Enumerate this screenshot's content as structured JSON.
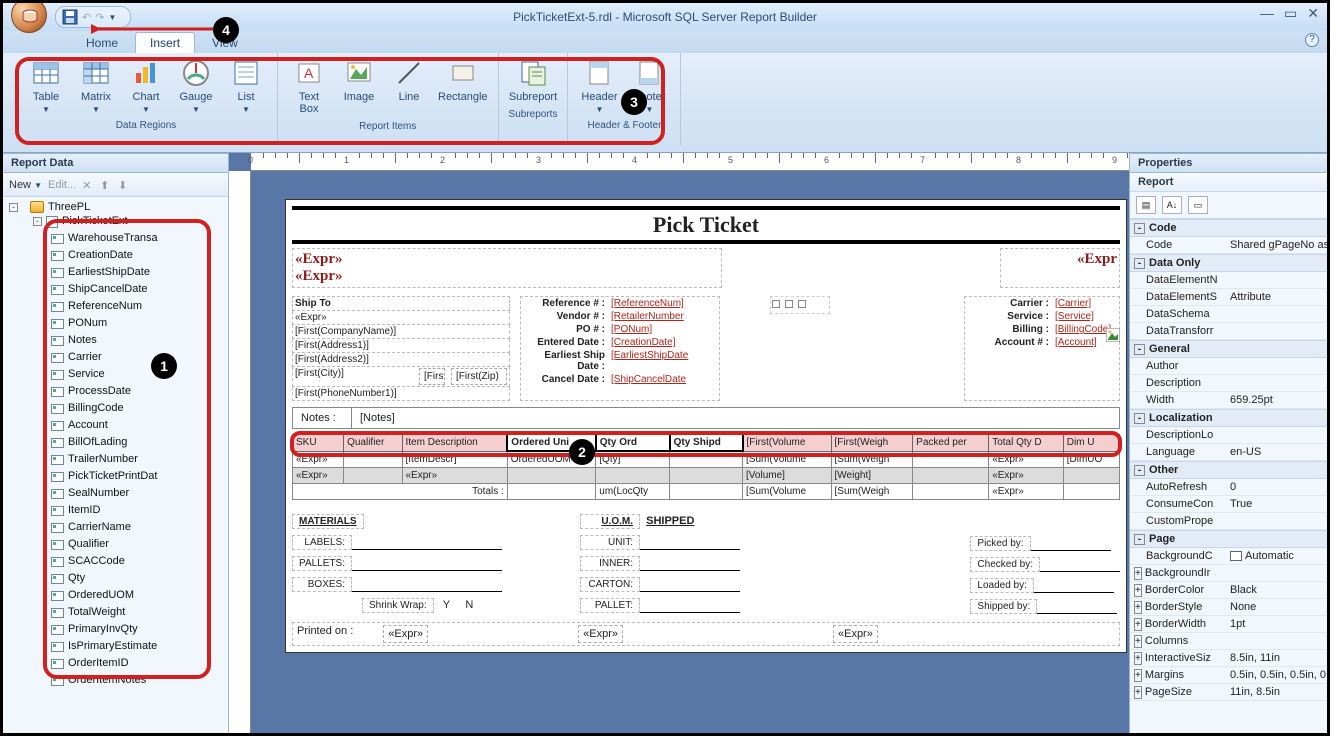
{
  "title": "PickTicketExt-5.rdl - Microsoft SQL Server Report Builder",
  "tabs": [
    "Home",
    "Insert",
    "View"
  ],
  "active_tab": 1,
  "ribbon": {
    "groups": [
      {
        "label": "Data Regions",
        "items": [
          {
            "name": "table-btn",
            "label": "Table",
            "dd": true
          },
          {
            "name": "matrix-btn",
            "label": "Matrix",
            "dd": true
          },
          {
            "name": "chart-btn",
            "label": "Chart",
            "dd": true
          },
          {
            "name": "gauge-btn",
            "label": "Gauge",
            "dd": true
          },
          {
            "name": "list-btn",
            "label": "List",
            "dd": true
          }
        ]
      },
      {
        "label": "Report Items",
        "items": [
          {
            "name": "textbox-btn",
            "label": "Text\nBox"
          },
          {
            "name": "image-btn",
            "label": "Image"
          },
          {
            "name": "line-btn",
            "label": "Line"
          },
          {
            "name": "rectangle-btn",
            "label": "Rectangle"
          }
        ]
      },
      {
        "label": "Subreports",
        "items": [
          {
            "name": "subreport-btn",
            "label": "Subreport"
          }
        ]
      },
      {
        "label": "Header & Footer",
        "items": [
          {
            "name": "header-btn",
            "label": "Header",
            "dd": true
          },
          {
            "name": "footer-btn",
            "label": "Footer",
            "dd": true
          }
        ]
      }
    ]
  },
  "callouts": {
    "c1": "1",
    "c2": "2",
    "c3": "3",
    "c4": "4"
  },
  "leftpanel": {
    "title": "Report Data",
    "new": "New",
    "edit": "Edit...",
    "datasource": "ThreePL",
    "dataset": "PickTicketExt",
    "fields": [
      "WarehouseTransa",
      "CreationDate",
      "EarliestShipDate",
      "ShipCancelDate",
      "ReferenceNum",
      "PONum",
      "Notes",
      "Carrier",
      "Service",
      "ProcessDate",
      "BillingCode",
      "Account",
      "BillOfLading",
      "TrailerNumber",
      "PickTicketPrintDat",
      "SealNumber",
      "ItemID",
      "CarrierName",
      "Qualifier",
      "SCACCode",
      "Qty",
      "OrderedUOM",
      "TotalWeight",
      "PrimaryInvQty",
      "IsPrimaryEstimate",
      "OrderItemID",
      "OrderItemNotes"
    ]
  },
  "report": {
    "title": "Pick Ticket",
    "expr": "«Expr»",
    "shipto": "Ship To",
    "shipfields": [
      "«Expr»",
      "[First(CompanyName)]",
      "[First(Address1)]",
      "[First(Address2)]",
      "[First(City)]",
      "[First(PhoneNumber1)]"
    ],
    "shipaux": [
      "[Firs",
      "[First(Zip)"
    ],
    "refs": [
      {
        "k": "Reference # :",
        "v": "[ReferenceNum]"
      },
      {
        "k": "Vendor # :",
        "v": "[RetailerNumber"
      },
      {
        "k": "PO # :",
        "v": "[PONum]"
      },
      {
        "k": "Entered Date :",
        "v": "[CreationDate]"
      },
      {
        "k": "Earliest Ship Date :",
        "v": "[EarliestShipDate"
      },
      {
        "k": "Cancel Date :",
        "v": "[ShipCancelDate"
      }
    ],
    "carrier": [
      {
        "k": "Carrier :",
        "v": "[Carrier]"
      },
      {
        "k": "Service :",
        "v": "[Service]"
      },
      {
        "k": "Billing :",
        "v": "[BillingCode]"
      },
      {
        "k": "Account # :",
        "v": "[Account]"
      }
    ],
    "notes_label": "Notes :",
    "notes_val": "[Notes]",
    "cols": [
      "SKU",
      "Qualifier",
      "Item Description",
      "Ordered Uni",
      "Qty Ord",
      "Qty Shipd",
      "[First(Volume",
      "[First(Weigh",
      "Packed per",
      "Total Qty D",
      "Dim U"
    ],
    "row1": [
      "«Expr»",
      "",
      "[ItemDescr]",
      "OrderedUOM",
      "[Qty]",
      "",
      "[Sum(Volume",
      "[Sum(Weigh",
      "",
      "«Expr»",
      "[DimUO"
    ],
    "row2": [
      "«Expr»",
      "",
      "«Expr»",
      "",
      "",
      "",
      "[Volume]",
      "[Weight]",
      "",
      "«Expr»",
      ""
    ],
    "row3_label": "Totals :",
    "row3": [
      "",
      "",
      "",
      "",
      "um(LocQty",
      "",
      "[Sum(Volume",
      "[Sum(Weigh",
      "",
      "«Expr»",
      ""
    ],
    "materials": "MATERIALS",
    "uom": "U.O.M.",
    "shipped": "SHIPPED",
    "mats": [
      "LABELS:",
      "PALLETS:",
      "BOXES:"
    ],
    "uoms": [
      "UNIT:",
      "INNER:",
      "CARTON:",
      "PALLET:"
    ],
    "shrink": "Shrink Wrap:",
    "y": "Y",
    "n": "N",
    "bywho": [
      "Picked by:",
      "Checked by:",
      "Loaded by:",
      "Shipped by:"
    ],
    "printed": "Printed on :"
  },
  "props": {
    "title": "Properties",
    "object": "Report",
    "cats": [
      {
        "name": "Code",
        "rows": [
          [
            "Code",
            "Shared gPageNo as"
          ]
        ]
      },
      {
        "name": "Data Only",
        "rows": [
          [
            "DataElementN",
            ""
          ],
          [
            "DataElementS",
            "Attribute"
          ],
          [
            "DataSchema",
            ""
          ],
          [
            "DataTransforr",
            ""
          ]
        ]
      },
      {
        "name": "General",
        "rows": [
          [
            "Author",
            ""
          ],
          [
            "Description",
            ""
          ],
          [
            "Width",
            "659.25pt"
          ]
        ]
      },
      {
        "name": "Localization",
        "rows": [
          [
            "DescriptionLo",
            ""
          ],
          [
            "Language",
            "en-US"
          ]
        ]
      },
      {
        "name": "Other",
        "rows": [
          [
            "AutoRefresh",
            "0"
          ],
          [
            "ConsumeCon",
            "True"
          ],
          [
            "CustomPrope",
            ""
          ]
        ]
      },
      {
        "name": "Page",
        "rows": [
          [
            "BackgroundC",
            "Automatic"
          ],
          [
            "BackgroundIr",
            ""
          ],
          [
            "BorderColor",
            "Black"
          ],
          [
            "BorderStyle",
            "None"
          ],
          [
            "BorderWidth",
            "1pt"
          ],
          [
            "Columns",
            ""
          ],
          [
            "InteractiveSiz",
            "8.5in, 11in"
          ],
          [
            "Margins",
            "0.5in, 0.5in, 0.5in, 0."
          ],
          [
            "PageSize",
            "11in, 8.5in"
          ]
        ]
      }
    ]
  }
}
